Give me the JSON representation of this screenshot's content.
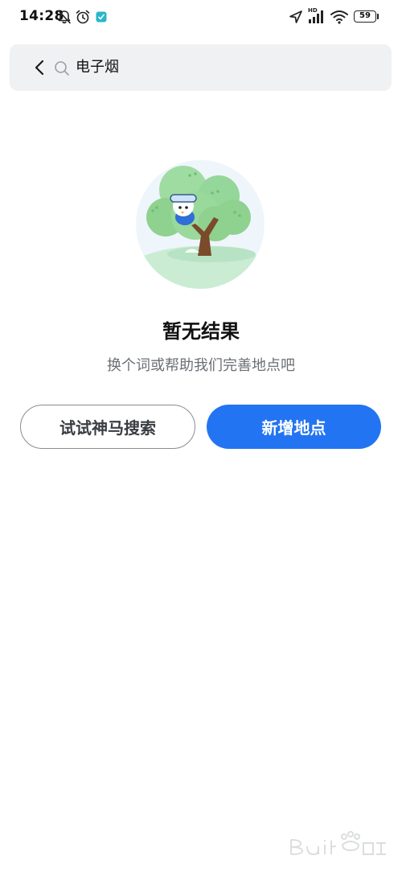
{
  "status_bar": {
    "time": "14:28",
    "network_label": "HD",
    "battery_level": "59",
    "icons": [
      "mute-bell-icon",
      "alarm-icon",
      "notification-app-icon",
      "location-icon",
      "signal-icon",
      "wifi-icon",
      "battery-icon"
    ]
  },
  "search": {
    "query": "电子烟",
    "back_icon": "chevron-left-icon",
    "search_icon": "search-icon"
  },
  "empty_state": {
    "illustration": "tree-with-mascot-illustration",
    "title": "暂无结果",
    "subtitle": "换个词或帮助我们完善地点吧"
  },
  "actions": {
    "secondary_label": "试试神马搜索",
    "primary_label": "新增地点"
  },
  "watermark": {
    "logo": "baidu-jingyan-logo"
  },
  "colors": {
    "primary": "#2374f2",
    "search_bg": "#f0f1f3",
    "subtitle": "#6b6f75",
    "outline": "#8a8d92",
    "tree_green": "#8fd18f"
  }
}
